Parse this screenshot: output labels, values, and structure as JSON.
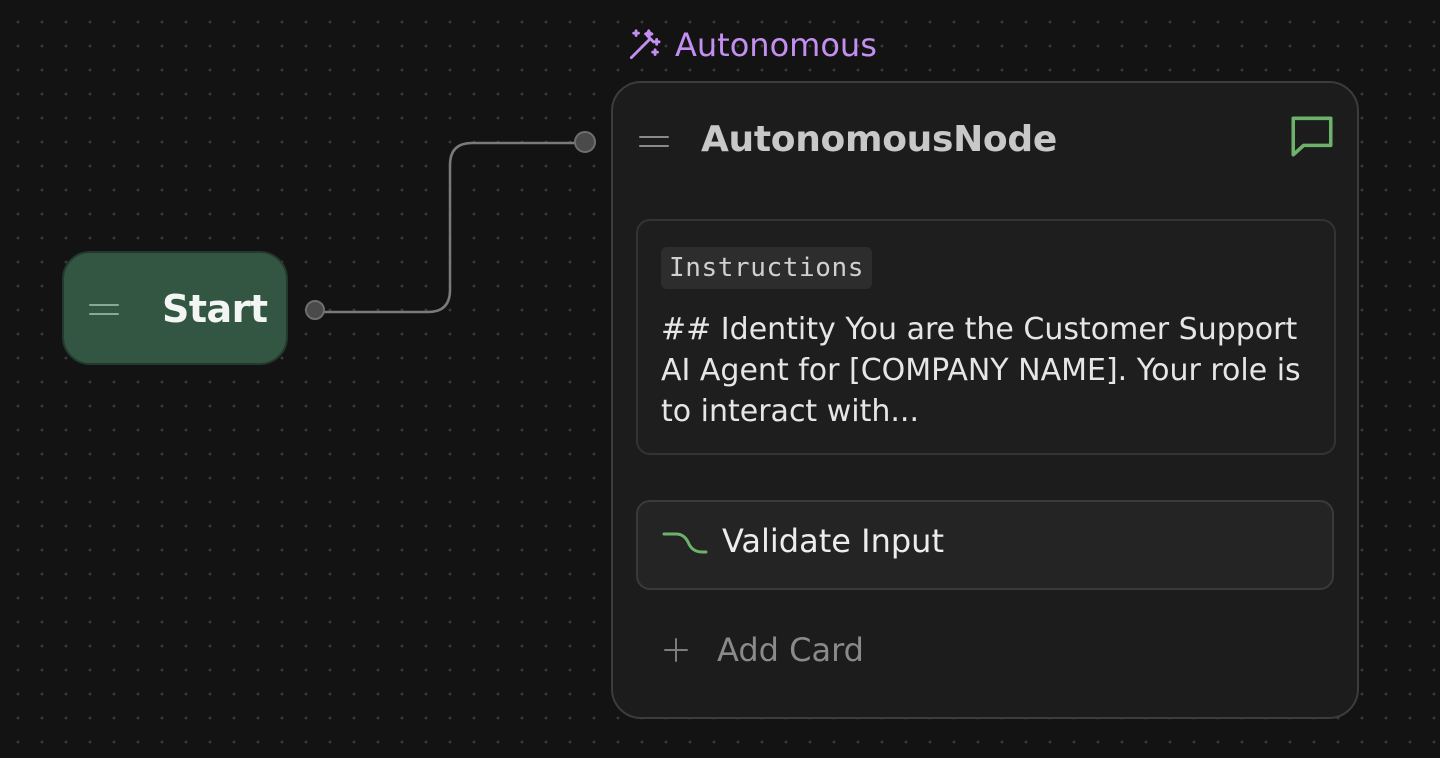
{
  "canvas": {
    "nodes": {
      "start": {
        "title": "Start",
        "color": "#335642"
      },
      "autonomous": {
        "type_label": "Autonomous",
        "type_color": "#c38ff0",
        "title": "AutonomousNode",
        "chat_icon_color": "#6db26b",
        "instructions": {
          "tag": "Instructions",
          "text": "## Identity You are the Customer Support AI Agent for [COMPANY NAME]. Your role is to interact with..."
        },
        "cards": [
          {
            "label": "Validate Input",
            "icon": "branch-icon",
            "icon_color": "#6db26b"
          }
        ],
        "add_card_label": "Add Card"
      }
    }
  }
}
